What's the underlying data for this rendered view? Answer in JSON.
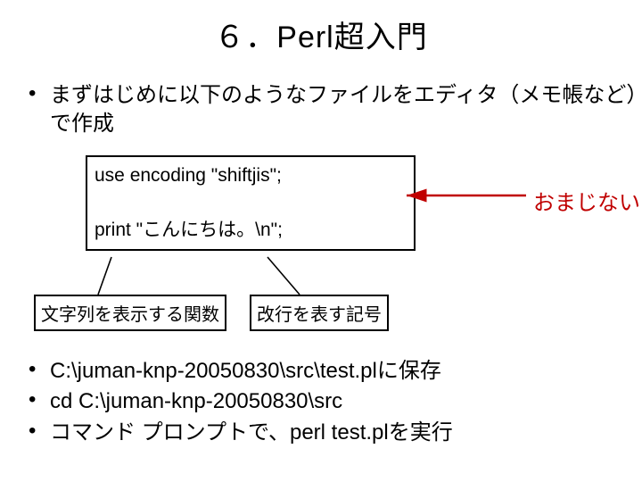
{
  "title": "６．Perl超入門",
  "intro_bullet": "まずはじめに以下のようなファイルをエディタ（メモ帳など）で作成",
  "code": {
    "line1": "use encoding \"shiftjis\";",
    "line2": "print \"こんにちは。\\n\";"
  },
  "annot_right": "おまじない",
  "annot_left": "文字列を表示する関数",
  "annot_mid": "改行を表す記号",
  "steps": [
    "C:\\juman-knp-20050830\\src\\test.plに保存",
    "cd C:\\juman-knp-20050830\\src",
    "コマンド プロンプトで、perl test.plを実行"
  ]
}
